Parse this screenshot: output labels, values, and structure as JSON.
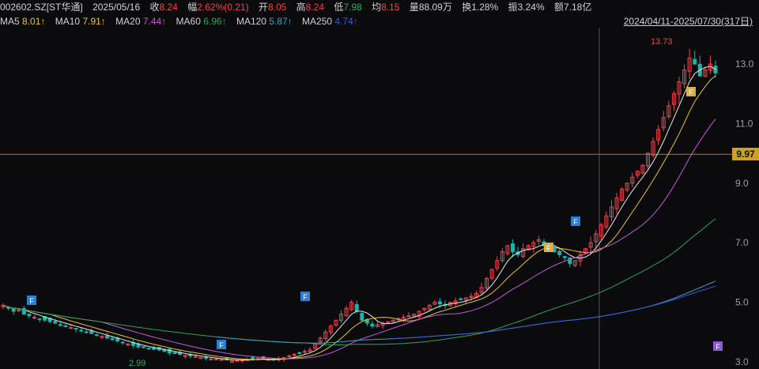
{
  "header": {
    "code": "002602.SZ[ST华通]",
    "date": "2025/05/16",
    "close_label": "收",
    "close": "8.24",
    "change_label": "幅",
    "change": "2.62%(0.21)",
    "open_label": "开",
    "open": "8.05",
    "high_label": "高",
    "high": "8.24",
    "low_label": "低",
    "low": "7.98",
    "avg_label": "均",
    "avg": "8.15",
    "vol_label": "量",
    "vol": "88.09万",
    "turnover_label": "换",
    "turnover": "1.28%",
    "amp_label": "振",
    "amp": "3.24%",
    "amount_label": "额",
    "amount": "7.18亿"
  },
  "ma_row": {
    "ma5_label": "MA5",
    "ma5": "8.01↑",
    "ma10_label": "MA10",
    "ma10": "7.91↑",
    "ma20_label": "MA20",
    "ma20": "7.44↑",
    "ma60_label": "MA60",
    "ma60": "6.96↑",
    "ma120_label": "MA120",
    "ma120": "5.87↑",
    "ma250_label": "MA250",
    "ma250": "4.74↑",
    "range": "2024/04/11-2025/07/30(317日)"
  },
  "colors": {
    "up": "#f2444d",
    "down": "#1fb3a6",
    "ma5": "#e8e8e8",
    "ma10": "#e8c23a",
    "ma20": "#c45ad6",
    "ma60": "#2fa05a",
    "ma120": "#3aa0c8",
    "ma250": "#3d5bd6",
    "crosshair": "#c96b2a",
    "marker_f_blue": "#2d7fd0",
    "marker_f_gold": "#d6b04a",
    "marker_f_purple": "#8a5ad0"
  },
  "current_price": "9.97",
  "chart_data": {
    "type": "candlestick",
    "title": "",
    "ylim": [
      3.0,
      14.0
    ],
    "y_ticks": [
      "13.0",
      "11.0",
      "9.0",
      "7.0",
      "5.0",
      "3.0"
    ],
    "max_label": "13.73",
    "min_label": "2.99",
    "markers": [
      "F",
      "F",
      "F",
      "F",
      "F",
      "F"
    ],
    "closes": [
      4.9,
      4.8,
      4.7,
      4.75,
      4.6,
      4.55,
      4.5,
      4.45,
      4.4,
      4.35,
      4.3,
      4.25,
      4.2,
      4.15,
      4.1,
      4.05,
      4.0,
      3.95,
      3.9,
      3.85,
      3.8,
      3.75,
      3.7,
      3.65,
      3.6,
      3.55,
      3.5,
      3.48,
      3.45,
      3.42,
      3.4,
      3.35,
      3.3,
      3.28,
      3.25,
      3.22,
      3.2,
      3.18,
      3.15,
      3.12,
      3.1,
      3.1,
      3.08,
      3.06,
      3.05,
      3.05,
      3.06,
      3.08,
      3.1,
      3.12,
      3.1,
      3.08,
      3.06,
      3.1,
      3.15,
      3.2,
      3.25,
      3.3,
      3.35,
      3.4,
      3.6,
      3.8,
      4.0,
      4.2,
      4.4,
      4.6,
      4.8,
      5.0,
      4.7,
      4.4,
      4.3,
      4.2,
      4.25,
      4.3,
      4.35,
      4.4,
      4.45,
      4.5,
      4.55,
      4.6,
      4.7,
      4.8,
      4.9,
      5.0,
      4.95,
      4.9,
      5.0,
      5.05,
      5.1,
      5.15,
      5.2,
      5.3,
      5.5,
      5.8,
      6.1,
      6.4,
      6.7,
      6.9,
      6.7,
      6.6,
      6.8,
      6.9,
      7.0,
      7.1,
      6.9,
      6.8,
      6.7,
      6.6,
      6.5,
      6.3,
      6.4,
      6.6,
      6.8,
      7.0,
      7.3,
      7.6,
      7.9,
      8.2,
      8.5,
      8.8,
      9.0,
      9.2,
      9.4,
      9.6,
      10.0,
      10.4,
      10.8,
      11.2,
      11.6,
      12.0,
      12.4,
      12.8,
      13.2,
      13.0,
      12.6,
      12.8,
      13.0,
      12.7
    ]
  }
}
